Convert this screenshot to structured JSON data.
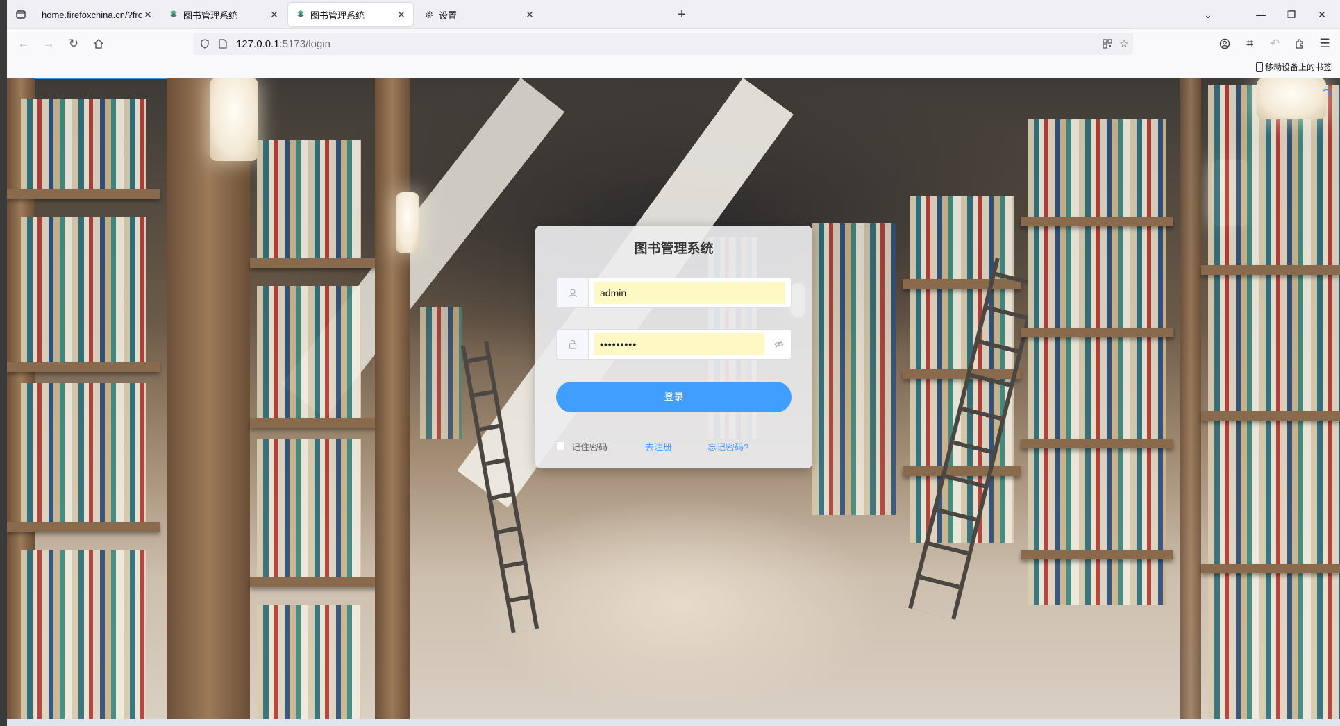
{
  "tabs": [
    {
      "title": "home.firefoxchina.cn/?from=extra_start",
      "active": false,
      "favicon": "none"
    },
    {
      "title": "图书管理系统",
      "active": false,
      "favicon": "app-logo-icon"
    },
    {
      "title": "图书管理系统",
      "active": true,
      "favicon": "app-logo-icon"
    },
    {
      "title": "设置",
      "active": false,
      "favicon": "gear-icon"
    }
  ],
  "urlbar": {
    "host": "127.0.0.1",
    "path": ":5173/login"
  },
  "bookmarks": {
    "mobile_label": "移动设备上的书签"
  },
  "login": {
    "title": "图书管理系统",
    "username_value": "admin",
    "password_value": "•••••••••",
    "submit_label": "登录",
    "remember_label": "记住密码",
    "register_label": "去注册",
    "forgot_label": "忘记密码?"
  },
  "colors": {
    "primary": "#409eff",
    "autofill": "#fdf8c4"
  }
}
